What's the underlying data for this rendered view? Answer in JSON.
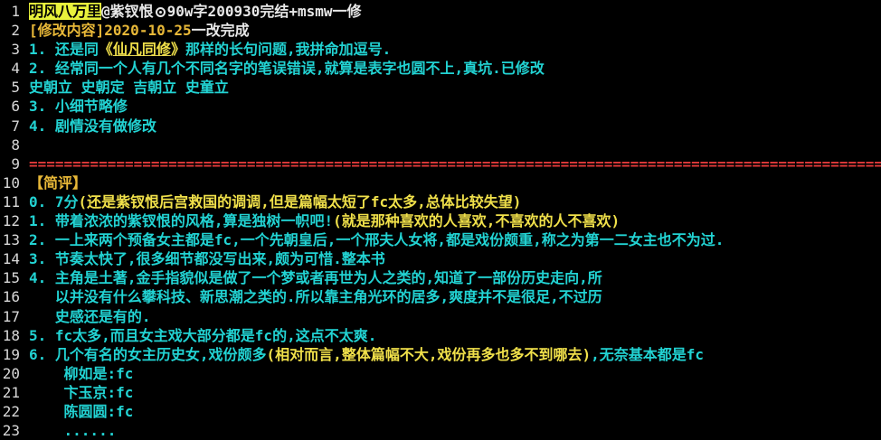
{
  "colors": {
    "background": "#000000",
    "line_number": "#d8d8d8",
    "cyan": "#22d3d3",
    "yellow": "#f0e04a",
    "orange": "#e8b838",
    "green": "#67e35a",
    "red": "#e23a3a",
    "title_highlight": "#e8f23c"
  },
  "editor": {
    "lines": [
      {
        "n": "1",
        "segments": [
          {
            "text": "明风八万里",
            "cls": "hl-title"
          },
          {
            "text": "@紫钗恨",
            "cls": "c-white"
          },
          {
            "icon": "circle-icon"
          },
          {
            "text": "90w字200930完结+msmw一修",
            "cls": "c-white"
          }
        ]
      },
      {
        "n": "2",
        "segments": [
          {
            "text": "[修改内容]",
            "cls": "c-orange"
          },
          {
            "text": "2020-10-25",
            "cls": "c-orange"
          },
          {
            "text": "一改完成",
            "cls": "c-white"
          }
        ]
      },
      {
        "n": "3",
        "segments": [
          {
            "text": "1. 还是同",
            "cls": "c-cyan"
          },
          {
            "text": "《",
            "cls": "c-yellow"
          },
          {
            "text": "仙凡同修",
            "cls": "c-yellow hl-ul"
          },
          {
            "text": "》",
            "cls": "c-yellow"
          },
          {
            "text": "那样的长句问题,我拼命加逗号.",
            "cls": "c-cyan"
          }
        ]
      },
      {
        "n": "4",
        "segments": [
          {
            "text": "2. 经常同一个人有几个不同名字的笔误错误,就算是表字也圆不上,真坑.已修改",
            "cls": "c-cyan"
          }
        ]
      },
      {
        "n": "5",
        "segments": [
          {
            "text": "史朝立 史朝定 吉朝立 史童立",
            "cls": "c-cyan"
          }
        ]
      },
      {
        "n": "6",
        "segments": [
          {
            "text": "3. 小细节略修",
            "cls": "c-cyan"
          }
        ]
      },
      {
        "n": "7",
        "segments": [
          {
            "text": "4. 剧情没有做修改",
            "cls": "c-cyan"
          }
        ]
      },
      {
        "n": "8",
        "segments": []
      },
      {
        "n": "9",
        "segments": [
          {
            "text": "==================================================================================================",
            "cls": "c-red"
          }
        ]
      },
      {
        "n": "10",
        "segments": [
          {
            "text": "【简评】",
            "cls": "c-orange"
          }
        ]
      },
      {
        "n": "11",
        "segments": [
          {
            "text": "0. 7分",
            "cls": "c-cyan"
          },
          {
            "text": "(还是紫钗恨后宫救国的调调,但是篇幅太短了fc太多,总体比较失望)",
            "cls": "c-yellow"
          }
        ]
      },
      {
        "n": "12",
        "segments": [
          {
            "text": "1. 带着浓浓的紫钗恨的风格,算是独树一帜吧!",
            "cls": "c-cyan"
          },
          {
            "text": "(就是那种喜欢的人喜欢,不喜欢的人不喜欢)",
            "cls": "c-yellow"
          }
        ]
      },
      {
        "n": "13",
        "segments": [
          {
            "text": "2. 一上来两个预备女主都是fc,一个先朝皇后,一个邢夫人女将,都是戏份颇重,称之为第一二女主也不为过.",
            "cls": "c-cyan"
          }
        ]
      },
      {
        "n": "14",
        "segments": [
          {
            "text": "3. 节奏太快了,很多细节都没写出来,颇为可惜.整本书",
            "cls": "c-cyan"
          }
        ]
      },
      {
        "n": "15",
        "segments": [
          {
            "text": "4. 主角是土著,金手指貌似是做了一个梦或者再世为人之类的,知道了一部份历史走向,所",
            "cls": "c-cyan"
          }
        ]
      },
      {
        "n": "16",
        "segments": [
          {
            "text": "   以并没有什么攀科技、新思潮之类的.所以靠主角光环的居多,爽度并不是很足,不过历",
            "cls": "c-cyan"
          }
        ]
      },
      {
        "n": "17",
        "segments": [
          {
            "text": "   史感还是有的.",
            "cls": "c-cyan"
          }
        ]
      },
      {
        "n": "18",
        "segments": [
          {
            "text": "5. fc太多,而且女主戏大部分都是fc的,这点不太爽.",
            "cls": "c-cyan"
          }
        ]
      },
      {
        "n": "19",
        "segments": [
          {
            "text": "6. 几个有名的女主历史女,戏份颇多",
            "cls": "c-cyan"
          },
          {
            "text": "(相对而言,整体篇幅不大,戏份再多也多不到哪去)",
            "cls": "c-yellow"
          },
          {
            "text": ",无奈基本都是fc",
            "cls": "c-cyan"
          }
        ]
      },
      {
        "n": "20",
        "segments": [
          {
            "text": "    柳如是:fc",
            "cls": "c-cyan"
          }
        ]
      },
      {
        "n": "21",
        "segments": [
          {
            "text": "    卞玉京:fc",
            "cls": "c-cyan"
          }
        ]
      },
      {
        "n": "22",
        "segments": [
          {
            "text": "    陈圆圆:fc",
            "cls": "c-cyan"
          }
        ]
      },
      {
        "n": "23",
        "segments": [
          {
            "text": "    ......",
            "cls": "c-cyan"
          }
        ]
      }
    ]
  }
}
